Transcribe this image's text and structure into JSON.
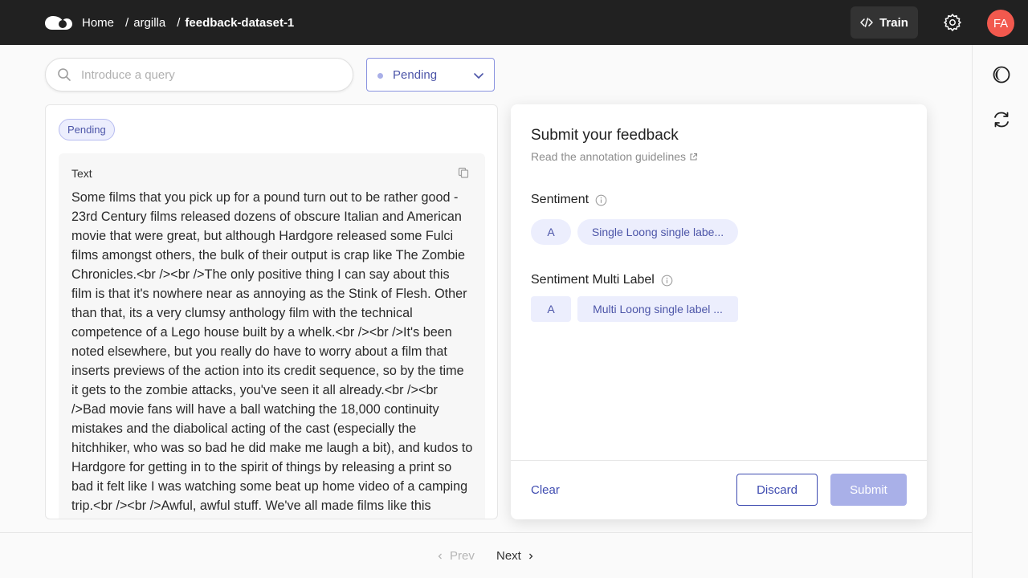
{
  "header": {
    "breadcrumbs": [
      "Home",
      "argilla",
      "feedback-dataset-1"
    ],
    "train_label": "Train",
    "avatar_initials": "FA",
    "avatar_color": "#f2594e"
  },
  "toolbar": {
    "search_placeholder": "Introduce a query",
    "status_filter": "Pending"
  },
  "record": {
    "status": "Pending",
    "field_title": "Text",
    "text": "Some films that you pick up for a pound turn out to be rather good - 23rd Century films released dozens of obscure Italian and American movie that were great, but although Hardgore released some Fulci films amongst others, the bulk of their output is crap like The Zombie Chronicles.<br /><br />The only positive thing I can say about this film is that it's nowhere near as annoying as the Stink of Flesh. Other than that, its a very clumsy anthology film with the technical competence of a Lego house built by a whelk.<br /><br />It's been noted elsewhere, but you really do have to worry about a film that inserts previews of the action into its credit sequence, so by the time it gets to the zombie attacks, you've seen it all already.<br /><br />Bad movie fans will have a ball watching the 18,000 continuity mistakes and the diabolical acting of the cast (especially the hitchhiker, who was so bad he did make me laugh a bit), and kudos to Hardgore for getting in to the spirit of things by releasing a print so bad it felt like I was watching some beat up home video of a camping trip.<br /><br />Awful, awful stuff. We've all made films like this"
  },
  "feedback": {
    "title": "Submit your feedback",
    "guidelines_link": "Read the annotation guidelines",
    "questions": [
      {
        "title": "Sentiment",
        "options": [
          "A",
          "Single Loong single labe..."
        ]
      },
      {
        "title": "Sentiment Multi Label",
        "options": [
          "A",
          "Multi Loong single label ..."
        ]
      }
    ],
    "clear_label": "Clear",
    "discard_label": "Discard",
    "submit_label": "Submit"
  },
  "pagination": {
    "prev_label": "Prev",
    "next_label": "Next"
  },
  "colors": {
    "primary": "#3e4bb0",
    "chip_bg": "#eceefd",
    "header_bg": "#212121"
  }
}
